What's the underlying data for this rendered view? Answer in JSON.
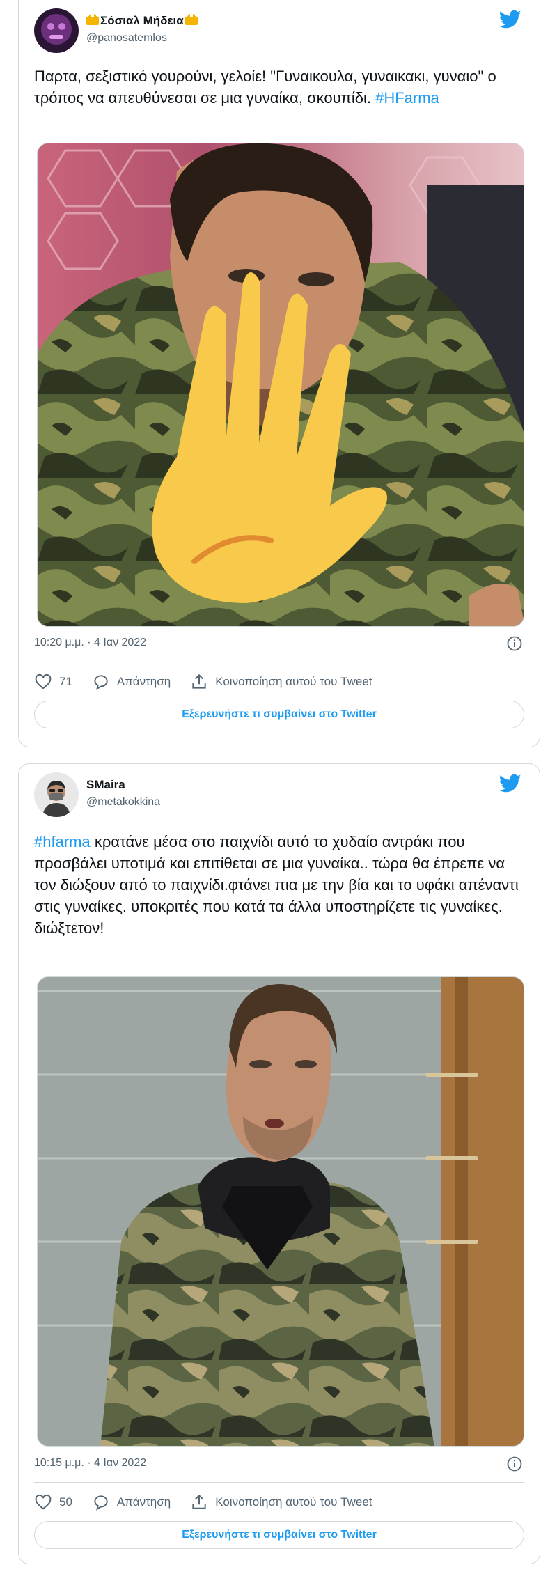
{
  "tweets": [
    {
      "display_name": "Σόσιαλ Μήδεια",
      "handle": "@panosatemlos",
      "text_plain": "Παρτα, σεξιστικό γουρούνι, γελοίε! \"Γυναικουλα, γυναικακι, γυναιο\" ο τρόπος να απευθύνεσαι σε μια γυναίκα, σκουπίδι.",
      "hashtag": "#HFarma",
      "timestamp": "10:20 μ.μ. · 4 Ιαν 2022",
      "likes": "71",
      "reply_label": "Απάντηση",
      "share_label": "Κοινοποίηση αυτού του Tweet",
      "explore_label": "Εξερευνήστε τι συμβαίνει στο Twitter"
    },
    {
      "display_name": "SMaira",
      "handle": "@metakokkina",
      "hashtag": "#hfarma",
      "text_plain": "κρατάνε μέσα στο παιχνίδι αυτό το χυδαίο αντράκι που προσβάλει υποτιμά και επιτίθεται σε μια γυναίκα.. τώρα θα έπρεπε να τον διώξουν από το παιχνίδι.φτάνει πια με την βία και το υφάκι απέναντι στις γυναίκες. υποκριτές που κατά τα άλλα υποστηρίζετε τις γυναίκες. διώξτετον!",
      "timestamp": "10:15 μ.μ. · 4 Ιαν 2022",
      "likes": "50",
      "reply_label": "Απάντηση",
      "share_label": "Κοινοποίηση αυτού του Tweet",
      "explore_label": "Εξερευνήστε τι συμβαίνει στο Twitter"
    }
  ],
  "colors": {
    "accent": "#1d9bf0",
    "text": "#0f1419",
    "muted": "#536471",
    "border": "#cfd9de"
  }
}
